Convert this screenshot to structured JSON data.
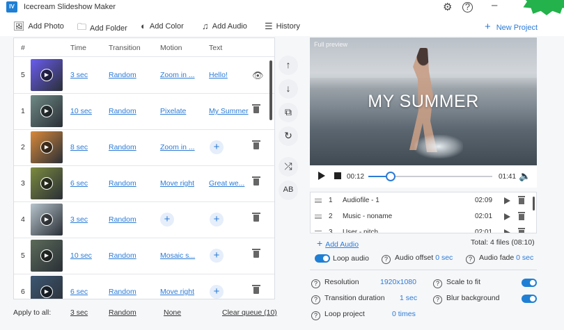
{
  "app": {
    "logo": "IV",
    "title": "Icecream Slideshow Maker",
    "accent": "#2b7bd6"
  },
  "toolbar": {
    "add_photo": "Add Photo",
    "add_folder": "Add Folder",
    "add_color": "Add Color",
    "add_audio": "Add Audio",
    "history": "History",
    "new_project": "New Project"
  },
  "queue": {
    "headers": {
      "num": "#",
      "time": "Time",
      "transition": "Transition",
      "motion": "Motion",
      "text": "Text"
    },
    "rows": [
      {
        "num": "5",
        "time": "3 sec",
        "transition": "Random",
        "motion": "Zoom in ...",
        "text": "Hello!",
        "thumb": "#6a5cf0",
        "action": "eye-icon"
      },
      {
        "num": "1",
        "time": "10 sec",
        "transition": "Random",
        "motion": "Pixelate",
        "text": "My Summer",
        "thumb": "#6f8a86",
        "action": "trash-icon"
      },
      {
        "num": "2",
        "time": "8 sec",
        "transition": "Random",
        "motion": "Zoom in ...",
        "text": "",
        "thumb": "#d98a3a",
        "action": "trash-icon"
      },
      {
        "num": "3",
        "time": "6 sec",
        "transition": "Random",
        "motion": "Move right",
        "text": "Great we...",
        "thumb": "#7c8b3e",
        "action": "trash-icon"
      },
      {
        "num": "4",
        "time": "3 sec",
        "transition": "Random",
        "motion": "",
        "text": "",
        "thumb": "#b7c4cc",
        "action": "trash-icon"
      },
      {
        "num": "5",
        "time": "10 sec",
        "transition": "Random",
        "motion": "Mosaic s...",
        "text": "",
        "thumb": "#5c6b5a",
        "action": "trash-icon"
      },
      {
        "num": "6",
        "time": "6 sec",
        "transition": "Random",
        "motion": "Move right",
        "text": "",
        "thumb": "#3d5772",
        "action": "trash-icon"
      }
    ]
  },
  "apply_all": {
    "label": "Apply to all:",
    "time": "3 sec",
    "transition": "Random",
    "motion": "None",
    "clear": "Clear queue (10)"
  },
  "preview": {
    "label": "Full preview",
    "overlay_text": "MY SUMMER",
    "current_time": "00:12",
    "total_time": "01:41",
    "progress": 0.18
  },
  "audio": {
    "files": [
      {
        "num": "1",
        "title": "Audiofile - 1",
        "duration": "02:09"
      },
      {
        "num": "2",
        "title": "Music - noname",
        "duration": "02:01"
      },
      {
        "num": "3",
        "title": "User - pitch",
        "duration": "02:01"
      }
    ],
    "add_label": "Add Audio",
    "total": "Total: 4 files (08:10)",
    "loop_label": "Loop audio",
    "loop_on": true,
    "offset_label": "Audio offset",
    "offset_value": "0 sec",
    "fade_label": "Audio fade",
    "fade_value": "0 sec"
  },
  "settings": {
    "resolution_label": "Resolution",
    "resolution_value": "1920x1080",
    "transition_label": "Transition duration",
    "transition_value": "1 sec",
    "loop_project_label": "Loop project",
    "loop_project_value": "0 times",
    "scale_label": "Scale to fit",
    "scale_on": true,
    "blur_label": "Blur background",
    "blur_on": true
  }
}
